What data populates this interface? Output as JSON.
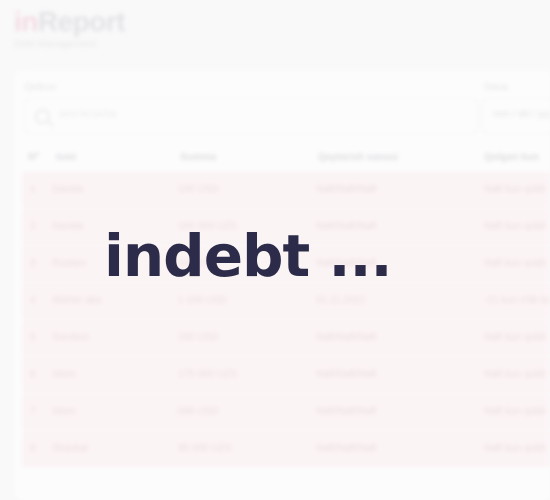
{
  "app": {
    "logo_prefix": "in",
    "logo_suffix": "Report",
    "subtitle": "Debt Management"
  },
  "filters": {
    "search_label": "Qidiruv:",
    "search_placeholder": "Ismi bo'yicha",
    "date_label": "Sana:",
    "date_value": "mm / dd / yyyy"
  },
  "table": {
    "columns": [
      "Nº",
      "Ismi",
      "Summa",
      "Qaytarish sanasi",
      "Qolgan kun"
    ],
    "rows": [
      {
        "num": "1",
        "name": "Davida",
        "amount": "100 USD",
        "date": "Naft/Naft/Naft",
        "days": "Naft kun qoldi"
      },
      {
        "num": "2",
        "name": "Davida",
        "amount": "100 000 UZS",
        "date": "Naft/Naft/Naft",
        "days": "Naft kun qoldi"
      },
      {
        "num": "3",
        "name": "Rustam",
        "amount": "100 USD",
        "date": "Naft/Naft/Naft",
        "days": "Naft kun qoldi"
      },
      {
        "num": "4",
        "name": "Alisher aka",
        "amount": "1 100 USD",
        "date": "01.11.2022",
        "days": "-21 kun o'tib ketdi"
      },
      {
        "num": "5",
        "name": "Sarvbon",
        "amount": "150 USD",
        "date": "Naft/Naft/Naft",
        "days": "Naft kun qoldi"
      },
      {
        "num": "6",
        "name": "Islom",
        "amount": "175 000 UZS",
        "date": "Naft/Naft/Naft",
        "days": "Naft kun qoldi"
      },
      {
        "num": "7",
        "name": "Islom",
        "amount": "696 USD",
        "date": "Naft/Naft/Naft",
        "days": "Naft kun qoldi"
      },
      {
        "num": "8",
        "name": "Shavkat",
        "amount": "95 000 UZS",
        "date": "Naft/Naft/Naft",
        "days": "Naft kun qoldi"
      }
    ]
  },
  "loading": {
    "text": "indebt ..."
  },
  "colors": {
    "overlay_text": "#2c2b4a",
    "row_background": "#fde8ea"
  }
}
